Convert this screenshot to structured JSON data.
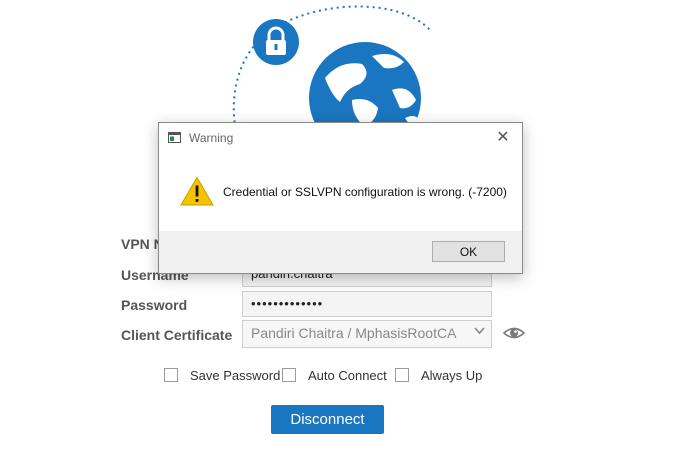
{
  "form": {
    "vpn_label": "VPN N",
    "username_label": "Username",
    "username_value": "pandiri.chaitra",
    "password_label": "Password",
    "password_value": "•••••••••••••",
    "certificate_label": "Client Certificate",
    "certificate_value": "Pandiri Chaitra / MphasisRootCA",
    "checkboxes": [
      {
        "label": "Save Password",
        "checked": false
      },
      {
        "label": "Auto Connect",
        "checked": false
      },
      {
        "label": "Always Up",
        "checked": false
      }
    ],
    "disconnect_label": "Disconnect"
  },
  "dialog": {
    "title": "Warning",
    "message": "Credential or SSLVPN configuration is wrong. (-7200)",
    "ok_label": "OK",
    "close_glyph": "✕"
  },
  "icons": {
    "lock": "lock-icon",
    "globe": "globe-icon",
    "warning": "warning-icon",
    "eye": "eye-icon",
    "chevron": "chevron-down-icon"
  },
  "colors": {
    "brand_blue": "#1a76c0",
    "warning_yellow": "#f5c400"
  }
}
